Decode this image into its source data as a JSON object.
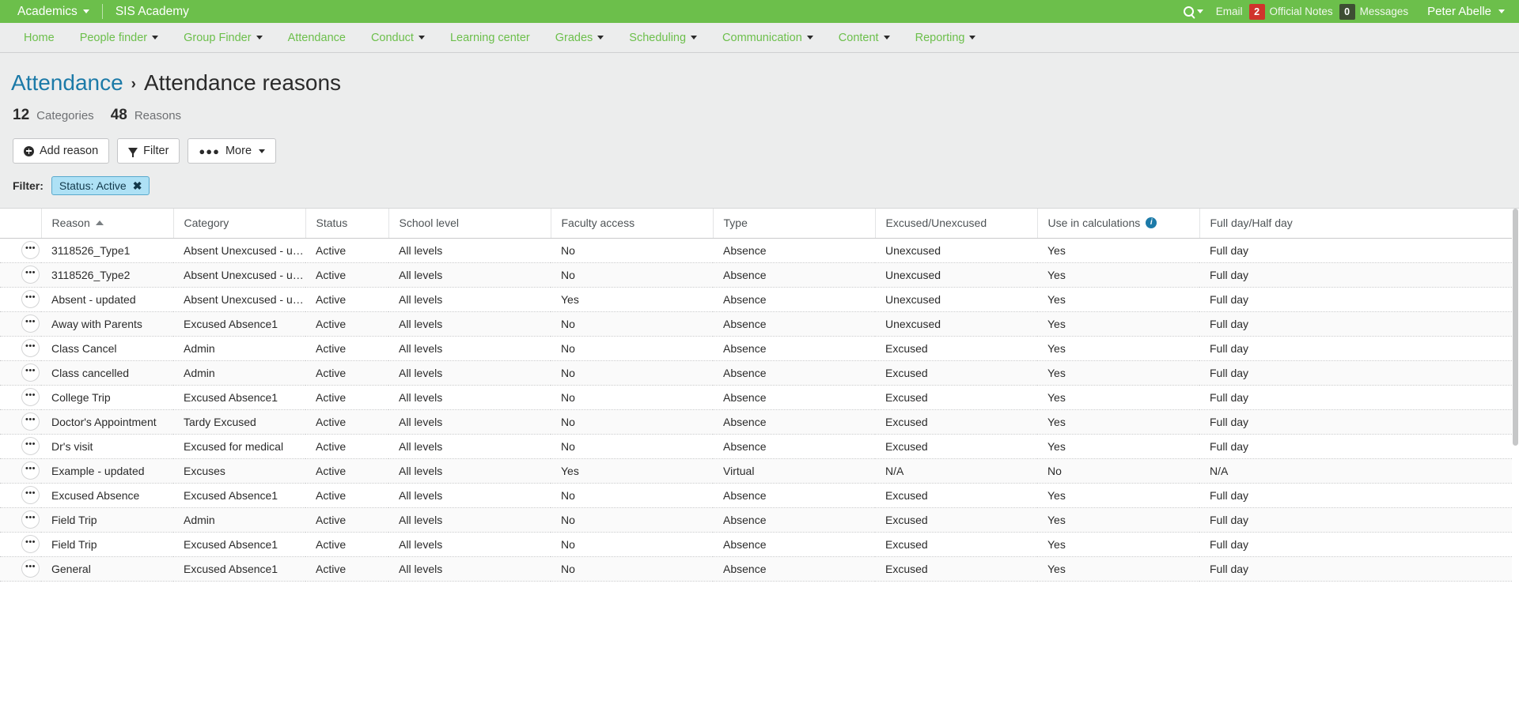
{
  "topbar": {
    "app_switcher_label": "Academics",
    "app_switcher_icon": "chevron-down-icon",
    "school_name": "SIS Academy",
    "search_icon": "search-icon",
    "email_label": "Email",
    "official_notes_count": "2",
    "official_notes_label": "Official Notes",
    "messages_count": "0",
    "messages_label": "Messages",
    "user_name": "Peter Abelle",
    "accent_green": "#6cbf4b",
    "badge_red": "#d0342c",
    "badge_dark": "#3e4e33"
  },
  "mainnav": {
    "items": [
      {
        "label": "Home",
        "has_caret": false
      },
      {
        "label": "People finder",
        "has_caret": true
      },
      {
        "label": "Group Finder",
        "has_caret": true
      },
      {
        "label": "Attendance",
        "has_caret": false
      },
      {
        "label": "Conduct",
        "has_caret": true
      },
      {
        "label": "Learning center",
        "has_caret": false
      },
      {
        "label": "Grades",
        "has_caret": true
      },
      {
        "label": "Scheduling",
        "has_caret": true
      },
      {
        "label": "Communication",
        "has_caret": true
      },
      {
        "label": "Content",
        "has_caret": true
      },
      {
        "label": "Reporting",
        "has_caret": true
      }
    ],
    "link_color": "#6cbf4b"
  },
  "breadcrumb": {
    "parent": "Attendance",
    "separator": "›",
    "current": "Attendance reasons",
    "link_color": "#1c7aa8"
  },
  "counts": {
    "categories_num": "12",
    "categories_label": "Categories",
    "reasons_num": "48",
    "reasons_label": "Reasons"
  },
  "toolbar": {
    "add_reason_label": "Add reason",
    "add_reason_icon": "plus-circle-icon",
    "filter_label": "Filter",
    "filter_icon": "funnel-icon",
    "more_label": "More",
    "more_icon": "ellipsis-icon",
    "more_caret_icon": "chevron-down-icon"
  },
  "filterbar": {
    "label": "Filter:",
    "chips": [
      {
        "text": "Status: Active",
        "remove_icon": "close-icon"
      }
    ],
    "chip_bg": "#aee1f5",
    "chip_border": "#5aa9cc"
  },
  "table": {
    "row_menu_icon": "ellipsis-icon",
    "columns": [
      {
        "key": "menu",
        "label": "",
        "sort": null,
        "info": false
      },
      {
        "key": "reason",
        "label": "Reason",
        "sort": "asc",
        "info": false
      },
      {
        "key": "category",
        "label": "Category",
        "sort": null,
        "info": false
      },
      {
        "key": "status",
        "label": "Status",
        "sort": null,
        "info": false
      },
      {
        "key": "school_level",
        "label": "School level",
        "sort": null,
        "info": false
      },
      {
        "key": "faculty_access",
        "label": "Faculty access",
        "sort": null,
        "info": false
      },
      {
        "key": "type",
        "label": "Type",
        "sort": null,
        "info": false
      },
      {
        "key": "excused",
        "label": "Excused/Unexcused",
        "sort": null,
        "info": false
      },
      {
        "key": "use_in_calculations",
        "label": "Use in calculations",
        "sort": null,
        "info": true
      },
      {
        "key": "full_half",
        "label": "Full day/Half day",
        "sort": null,
        "info": false
      }
    ],
    "rows": [
      {
        "reason": "3118526_Type1",
        "category": "Absent Unexcused - upd…",
        "status": "Active",
        "school_level": "All levels",
        "faculty_access": "No",
        "type": "Absence",
        "excused": "Unexcused",
        "use_in_calculations": "Yes",
        "full_half": "Full day"
      },
      {
        "reason": "3118526_Type2",
        "category": "Absent Unexcused - upd…",
        "status": "Active",
        "school_level": "All levels",
        "faculty_access": "No",
        "type": "Absence",
        "excused": "Unexcused",
        "use_in_calculations": "Yes",
        "full_half": "Full day"
      },
      {
        "reason": "Absent - updated",
        "category": "Absent Unexcused - upd…",
        "status": "Active",
        "school_level": "All levels",
        "faculty_access": "Yes",
        "type": "Absence",
        "excused": "Unexcused",
        "use_in_calculations": "Yes",
        "full_half": "Full day"
      },
      {
        "reason": "Away with Parents",
        "category": "Excused Absence1",
        "status": "Active",
        "school_level": "All levels",
        "faculty_access": "No",
        "type": "Absence",
        "excused": "Unexcused",
        "use_in_calculations": "Yes",
        "full_half": "Full day"
      },
      {
        "reason": "Class Cancel",
        "category": "Admin",
        "status": "Active",
        "school_level": "All levels",
        "faculty_access": "No",
        "type": "Absence",
        "excused": "Excused",
        "use_in_calculations": "Yes",
        "full_half": "Full day"
      },
      {
        "reason": "Class cancelled",
        "category": "Admin",
        "status": "Active",
        "school_level": "All levels",
        "faculty_access": "No",
        "type": "Absence",
        "excused": "Excused",
        "use_in_calculations": "Yes",
        "full_half": "Full day"
      },
      {
        "reason": "College Trip",
        "category": "Excused Absence1",
        "status": "Active",
        "school_level": "All levels",
        "faculty_access": "No",
        "type": "Absence",
        "excused": "Excused",
        "use_in_calculations": "Yes",
        "full_half": "Full day"
      },
      {
        "reason": "Doctor's Appointment",
        "category": "Tardy Excused",
        "status": "Active",
        "school_level": "All levels",
        "faculty_access": "No",
        "type": "Absence",
        "excused": "Excused",
        "use_in_calculations": "Yes",
        "full_half": "Full day"
      },
      {
        "reason": "Dr's visit",
        "category": "Excused for medical",
        "status": "Active",
        "school_level": "All levels",
        "faculty_access": "No",
        "type": "Absence",
        "excused": "Excused",
        "use_in_calculations": "Yes",
        "full_half": "Full day"
      },
      {
        "reason": "Example - updated",
        "category": "Excuses",
        "status": "Active",
        "school_level": "All levels",
        "faculty_access": "Yes",
        "type": "Virtual",
        "excused": "N/A",
        "use_in_calculations": "No",
        "full_half": "N/A"
      },
      {
        "reason": "Excused Absence",
        "category": "Excused Absence1",
        "status": "Active",
        "school_level": "All levels",
        "faculty_access": "No",
        "type": "Absence",
        "excused": "Excused",
        "use_in_calculations": "Yes",
        "full_half": "Full day"
      },
      {
        "reason": "Field Trip",
        "category": "Admin",
        "status": "Active",
        "school_level": "All levels",
        "faculty_access": "No",
        "type": "Absence",
        "excused": "Excused",
        "use_in_calculations": "Yes",
        "full_half": "Full day"
      },
      {
        "reason": "Field Trip",
        "category": "Excused Absence1",
        "status": "Active",
        "school_level": "All levels",
        "faculty_access": "No",
        "type": "Absence",
        "excused": "Excused",
        "use_in_calculations": "Yes",
        "full_half": "Full day"
      },
      {
        "reason": "General",
        "category": "Excused Absence1",
        "status": "Active",
        "school_level": "All levels",
        "faculty_access": "No",
        "type": "Absence",
        "excused": "Excused",
        "use_in_calculations": "Yes",
        "full_half": "Full day"
      }
    ]
  }
}
